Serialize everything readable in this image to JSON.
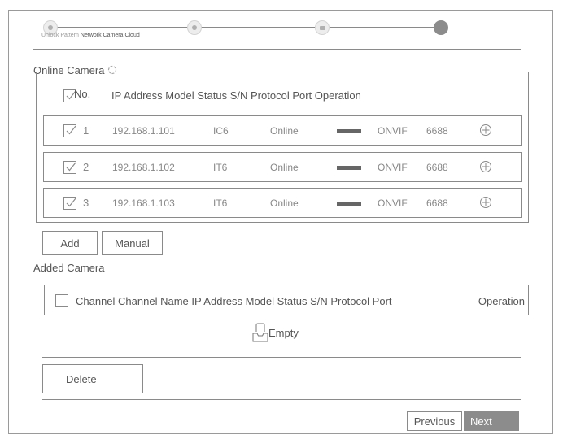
{
  "wizard": {
    "steps": [
      {
        "label": "Unlock Pattern",
        "state": "done",
        "icon": "lock-pattern-icon"
      },
      {
        "label": "Network Camera",
        "state": "done",
        "icon": "camera-icon"
      },
      {
        "label": "Cloud",
        "state": "done",
        "icon": "cloud-icon"
      },
      {
        "label": "",
        "state": "current",
        "icon": "step-dot-icon"
      }
    ]
  },
  "online": {
    "title": "Online Camera",
    "header": {
      "no": "No.",
      "columns": "IP Address Model Status S/N Protocol Port Operation"
    },
    "rows": [
      {
        "no": "1",
        "ip": "192.168.1.101",
        "model": "IC6",
        "status": "Online",
        "protocol": "ONVIF",
        "port": "6688"
      },
      {
        "no": "2",
        "ip": "192.168.1.102",
        "model": "IT6",
        "status": "Online",
        "protocol": "ONVIF",
        "port": "6688"
      },
      {
        "no": "3",
        "ip": "192.168.1.103",
        "model": "IT6",
        "status": "Online",
        "protocol": "ONVIF",
        "port": "6688"
      }
    ]
  },
  "buttons": {
    "add": "Add",
    "manual": "Manual",
    "delete": "Delete",
    "previous": "Previous",
    "next": "Next"
  },
  "added": {
    "title": "Added Camera",
    "header": {
      "columns": "Channel Channel Name  IP Address Model Status S/N Protocol Port",
      "operation": "Operation"
    },
    "empty": "Empty"
  },
  "colors": {
    "border": "#8a8a8a",
    "text": "#555555",
    "muted": "#888888",
    "next_bg": "#8c8c8c"
  }
}
